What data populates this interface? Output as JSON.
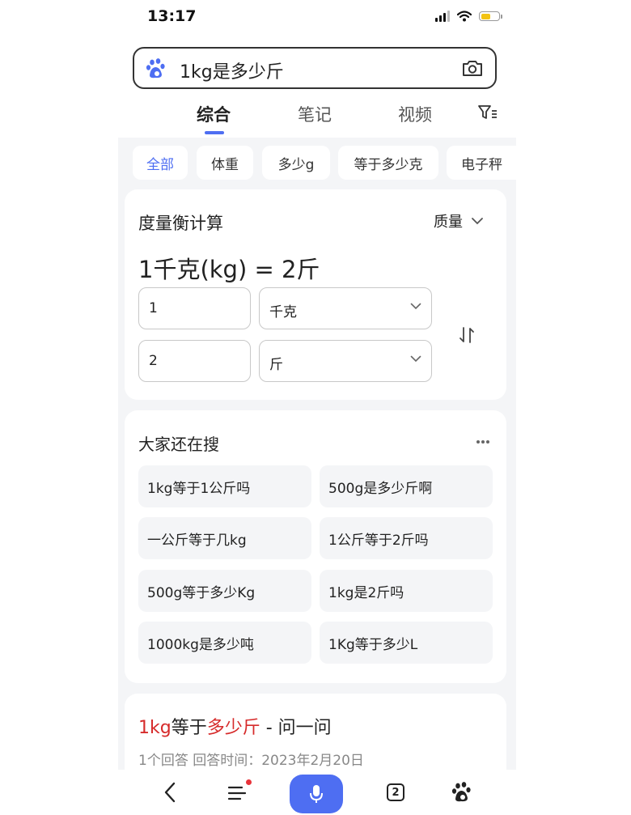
{
  "status": {
    "time": "13:17"
  },
  "search": {
    "query": "1kg是多少斤"
  },
  "tabs": [
    {
      "label": "综合",
      "active": true
    },
    {
      "label": "笔记",
      "active": false
    },
    {
      "label": "视频",
      "active": false
    }
  ],
  "chips": [
    "全部",
    "体重",
    "多少g",
    "等于多少克",
    "电子秤"
  ],
  "converter": {
    "title": "度量衡计算",
    "mode": "质量",
    "result": "1千克(kg) = 2斤",
    "from_value": "1",
    "from_unit": "千克",
    "to_value": "2",
    "to_unit": "斤"
  },
  "related": {
    "title": "大家还在搜",
    "items": [
      "1kg等于1公斤吗",
      "500g是多少斤啊",
      "一公斤等于几kg",
      "1公斤等于2斤吗",
      "500g等于多少Kg",
      "1kg是2斤吗",
      "1000kg是多少吨",
      "1Kg等于多少L"
    ]
  },
  "result": {
    "title_parts": [
      "1kg",
      "等于",
      "多少斤",
      " - 问一问"
    ],
    "meta": "1个回答   回答时间：2023年2月20日"
  },
  "bottom": {
    "tab_count": "2"
  },
  "colors": {
    "accent": "#4e6ef2",
    "highlight": "#d62b2b",
    "battery": "#f3c313"
  }
}
